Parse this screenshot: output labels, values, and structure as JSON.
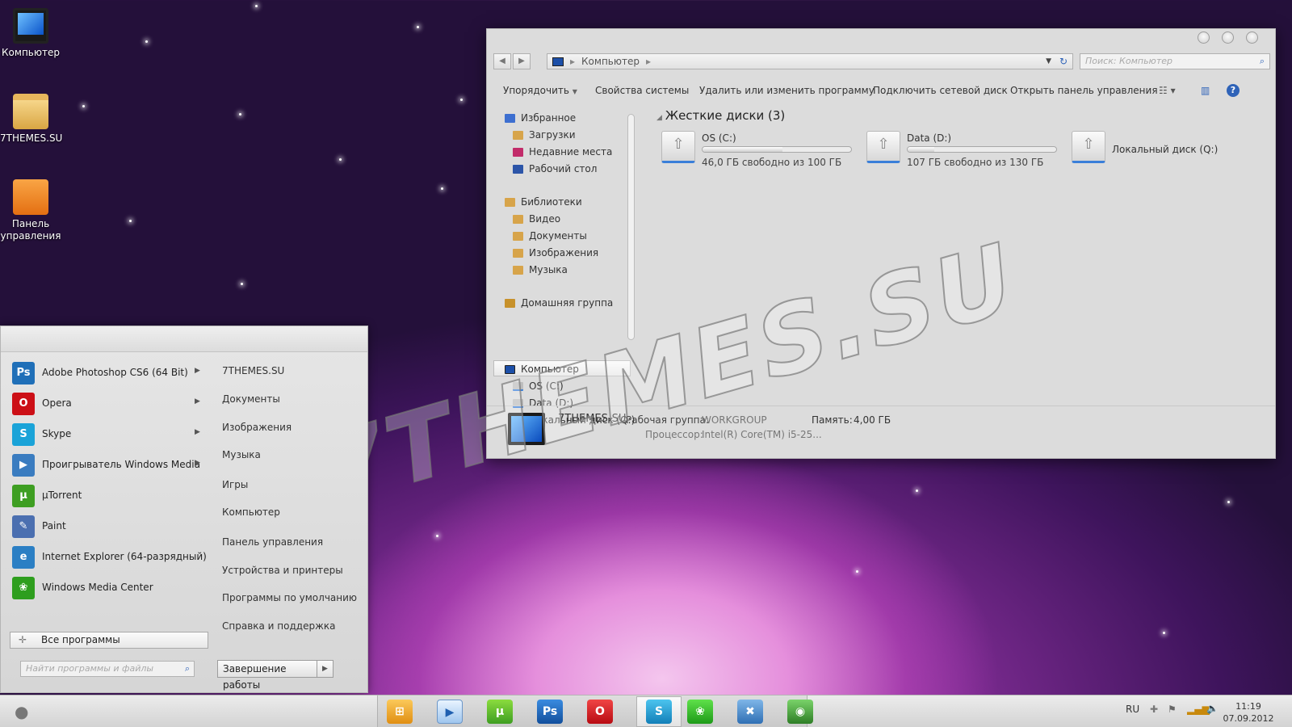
{
  "desktop": {
    "icons": [
      {
        "label": "Компьютер",
        "icon": "computer-icon"
      },
      {
        "label": "7THEMES.SU",
        "icon": "folder-icon"
      },
      {
        "label": "Панель управления",
        "icon": "control-panel-icon"
      }
    ],
    "watermark": "7THEMES.SU"
  },
  "explorer": {
    "address": "Компьютер",
    "search_placeholder": "Поиск: Компьютер",
    "toolbar": {
      "organize": "Упорядочить",
      "system_properties": "Свойства системы",
      "uninstall": "Удалить или изменить программу",
      "map_drive": "Подключить сетевой диск",
      "open_control_panel": "Открыть панель управления"
    },
    "nav": {
      "favorites": "Избранное",
      "downloads": "Загрузки",
      "recent": "Недавние места",
      "desktop": "Рабочий стол",
      "libraries": "Библиотеки",
      "video": "Видео",
      "documents": "Документы",
      "pictures": "Изображения",
      "music": "Музыка",
      "homegroup": "Домашняя группа",
      "computer": "Компьютер",
      "drive_c": "OS (C:)",
      "drive_d": "Data (D:)",
      "drive_q": "Локальный диск (Q:)"
    },
    "section_title": "Жесткие диски (3)",
    "drives": [
      {
        "name": "OS (C:)",
        "free_text": "46,0 ГБ свободно из 100 ГБ",
        "used_fraction": 0.54
      },
      {
        "name": "Data (D:)",
        "free_text": "107 ГБ свободно из 130 ГБ",
        "used_fraction": 0.18
      },
      {
        "name": "Локальный диск (Q:)"
      }
    ],
    "details": {
      "name": "7THEMES-SU",
      "workgroup_label": "Рабочая группа:",
      "workgroup_value": "WORKGROUP",
      "memory_label": "Память:",
      "memory_value": "4,00 ГБ",
      "cpu_label": "Процессор:",
      "cpu_value": "Intel(R) Core(TM) i5-25..."
    }
  },
  "start_menu": {
    "programs": [
      {
        "label": "Adobe Photoshop CS6 (64 Bit)",
        "icon": "Ps",
        "color": "#1f6fb8",
        "arrow": "▶"
      },
      {
        "label": "Opera",
        "icon": "O",
        "color": "#cc0f16",
        "arrow": "▶"
      },
      {
        "label": "Skype",
        "icon": "S",
        "color": "#1aa3d8",
        "arrow": "▶"
      },
      {
        "label": "Проигрыватель Windows Media",
        "icon": "▶",
        "color": "#3a7cc0",
        "arrow": "▶"
      },
      {
        "label": "µTorrent",
        "icon": "µ",
        "color": "#3e9e22"
      },
      {
        "label": "Paint",
        "icon": "✎",
        "color": "#4b6fb0"
      },
      {
        "label": "Internet Explorer (64-разрядный)",
        "icon": "e",
        "color": "#2b7fc4"
      },
      {
        "label": "Windows Media Center",
        "icon": "❀",
        "color": "#2e9e1e"
      }
    ],
    "all_programs": "Все программы",
    "right_items": [
      "7THEMES.SU",
      "Документы",
      "Изображения",
      "Музыка",
      "Игры",
      "Компьютер",
      "Панель управления",
      "Устройства и принтеры",
      "Программы по умолчанию",
      "Справка и поддержка"
    ],
    "search_placeholder": "Найти программы и файлы",
    "shutdown": "Завершение работы"
  },
  "taskbar": {
    "language": "RU",
    "time": "11:19",
    "date": "07.09.2012"
  }
}
